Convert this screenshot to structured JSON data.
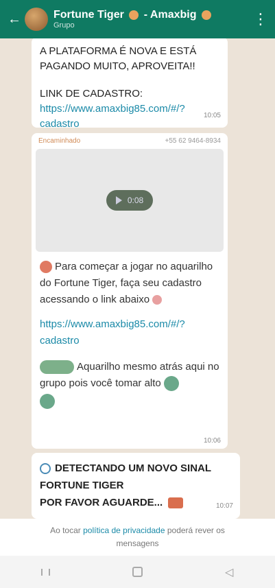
{
  "header": {
    "title": "Fortune Tiger",
    "title_suffix": "- Amaxbig",
    "subtitle": "Grupo",
    "back_glyph": "←",
    "menu_glyph": "⋮",
    "avatar_icon": "group-avatar-icon"
  },
  "messages": {
    "m1": {
      "line1": "A PLATAFORMA É NOVA E ESTÁ",
      "line2": "PAGANDO MUITO, APROVEITA!!",
      "link_label": "LINK DE CADASTRO:",
      "link_url": "https://www.amaxbig85.com/#/?cadastro",
      "time": "10:05"
    },
    "m2": {
      "forward_tag": "Encaminhado",
      "forward_meta": "+55 62 9464-8934",
      "media_duration": "0:08",
      "text1": "Para começar a jogar no aquarilho do Fortune Tiger, faça seu cadastro acessando o link abaixo",
      "link_url": "https://www.amaxbig85.com/#/?cadastro",
      "text2": "Aquarilho mesmo atrás aqui no grupo pois você tomar alto",
      "time": "10:06"
    },
    "m3": {
      "line1": "DETECTANDO UM NOVO SINAL",
      "line2": "FORTUNE TIGER",
      "line3": "POR FAVOR AGUARDE...",
      "time": "10:07"
    }
  },
  "notice": {
    "prefix": "Ao tocar ",
    "link": "política de privacidade",
    "suffix": " poderá rever os",
    "line2": "mensagens"
  },
  "nav": {
    "back_glyph": "◁"
  }
}
